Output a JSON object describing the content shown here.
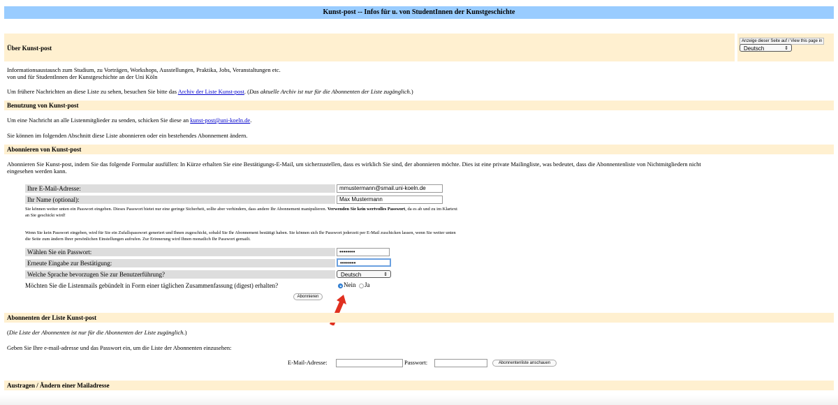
{
  "header": {
    "title": "Kunst-post -- Infos für u. von StudentInnen der Kunstgeschichte"
  },
  "about": {
    "heading": "Über Kunst-post",
    "desc_line1": "Informationsaustausch zum Studium, zu Vorträgen, Workshops, Ausstellungen, Praktika, Jobs, Veranstaltungen etc.",
    "desc_line2": "von und für StudentInnen der Kunstgeschichte an der Uni Köln",
    "archive_prefix": "Um frühere Nachrichten an diese Liste zu sehen, besuchen Sie bitte das ",
    "archive_link": "Archiv der Liste Kunst-post",
    "archive_suffix": ". (",
    "archive_note": "Das aktuelle Archiv ist nur für die Abonnenten der Liste zugänglich.",
    "archive_end": ")"
  },
  "language_box": {
    "label": "Anzeige dieser Seite auf / View this page in",
    "selected": "Deutsch"
  },
  "usage": {
    "heading": "Benutzung von Kunst-post",
    "send_prefix": "Um eine Nachricht an alle Listenmitglieder zu senden, schicken Sie diese an ",
    "send_email": "kunst-post@uni-koeln.de",
    "send_suffix": ".",
    "manage_text": "Sie können im folgenden Abschnitt diese Liste abonnieren oder ein bestehendes Abonnement ändern."
  },
  "subscribe": {
    "heading": "Abonnieren von Kunst-post",
    "intro_line1": "Abonnieren Sie Kunst-post, indem Sie das folgende Formular ausfüllen: In Kürze erhalten Sie eine Bestätigungs-E-Mail, um sicherzustellen, dass es wirklich Sie sind, der abonnieren möchte. Dies ist eine private Mailingliste, was bedeutet, dass die Abonnentenliste von Nichtmitgliedern nicht",
    "intro_line2": "eingesehen werden kann.",
    "email_label": "Ihre E-Mail-Adresse:",
    "email_value": "mmustermann@smail.uni-koeln.de",
    "name_label": "Ihr Name (optional):",
    "name_value": "Max Mustermann",
    "pw_note1_a": "Sie können weiter unten ein Passwort eingeben. Dieses Passwort bietet nur eine geringe Sicherheit, sollte aber verhindern, dass andere Ihr Abonnement manipulieren. ",
    "pw_note1_b": "Verwenden Sie kein wertvolles Passwort",
    "pw_note1_c": ", da es ab und zu im Klartext",
    "pw_note1_d": "an Sie geschickt wird!",
    "pw_note2_a": "Wenn Sie kein Passwort eingeben, wird für Sie ein Zufallspasswort generiert und Ihnen zugeschickt, sobald Sie Ihr Abonnement bestätigt haben. Sie können sich Ihr Passwort jederzeit per E-Mail zuschicken lassen, wenn Sie weiter unten",
    "pw_note2_b": "die Seite zum ändern Ihrer persönlichen Einstellungen aufrufen. Zur Erinnerung wird Ihnen monatlich Ihr Passwort gemailt.",
    "pw_label": "Wählen Sie ein Passwort:",
    "pw_value": "••••••••",
    "pw_confirm_label": "Erneute Eingabe zur Bestätigung:",
    "pw_confirm_value": "••••••••",
    "lang_label": "Welche Sprache bevorzugen Sie zur Benutzerführung?",
    "lang_value": "Deutsch",
    "digest_label": "Möchten Sie die Listenmails gebündelt in Form einer täglichen Zusammenfassung (digest) erhalten?",
    "digest_no": "Nein",
    "digest_yes": "Ja",
    "submit": "Abonnieren"
  },
  "subscribers": {
    "heading": "Abonnenten der Liste Kunst-post",
    "note": "Die Liste der Abonnenten ist nur für die Abonnenten der Liste zugänglich.",
    "instruction": "Geben Sie Ihre e-mail-adresse und das Passwort ein, um die Liste der Abonnenten einzusehen:",
    "email_label": "E-Mail-Adresse:",
    "password_label": "Passwort:",
    "button": "Abonnentenliste anschauen"
  },
  "unsubscribe": {
    "heading": "Austragen / Ändern einer Mailadresse"
  },
  "colors": {
    "header_bar": "#99ccff",
    "section_band": "#fff0d0",
    "form_label_bg": "#dddddd",
    "link": "#0000cc",
    "arrow": "#e03020"
  }
}
